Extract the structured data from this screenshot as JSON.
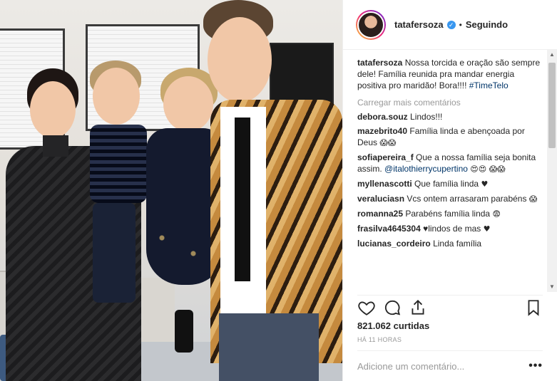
{
  "post": {
    "username": "tatafersoza",
    "separator": "•",
    "follow_status": "Seguindo",
    "caption_user": "tatafersoza",
    "caption_text": "Nossa torcida e oração são sempre dele! Família reunida pra mandar energia positiva pro maridão! Bora!!!!",
    "caption_tag": "#TimeTelo",
    "load_more": "Carregar mais comentários",
    "comments": [
      {
        "user": "debora.souz",
        "text": "Lindos!!!",
        "tail": ""
      },
      {
        "user": "mazebrito40",
        "text": "Família linda e abençoada por Deus",
        "tail": "😱😱"
      },
      {
        "user": "sofiapereira_f",
        "text": "Que a nossa família seja bonita assim.",
        "mention": "@italothierrycupertino",
        "tail": "😍😍 😱😱"
      },
      {
        "user": "myllenascotti",
        "text": "Que família linda",
        "tail": "♥"
      },
      {
        "user": "veraluciasn",
        "text": "Vcs ontem arrasaram parabéns",
        "tail": "😱"
      },
      {
        "user": "romanna25",
        "text": "Parabéns família linda",
        "tail": "😨"
      },
      {
        "user": "frasilva4645304",
        "text": "♥lindos de mas",
        "tail": "♥"
      },
      {
        "user": "lucianas_cordeiro",
        "text": "Linda família",
        "tail": ""
      }
    ],
    "likes": "821.062 curtidas",
    "time": "HÁ 11 HORAS",
    "add_comment_placeholder": "Adicione um comentário...",
    "more_options": "•••"
  },
  "icons": {
    "verified": "verified-badge-icon",
    "like": "heart-icon",
    "comment": "comment-bubble-icon",
    "share": "share-icon",
    "save": "bookmark-icon"
  },
  "colors": {
    "link": "#003569",
    "verified": "#3897f0",
    "muted": "#999999",
    "text": "#262626"
  }
}
